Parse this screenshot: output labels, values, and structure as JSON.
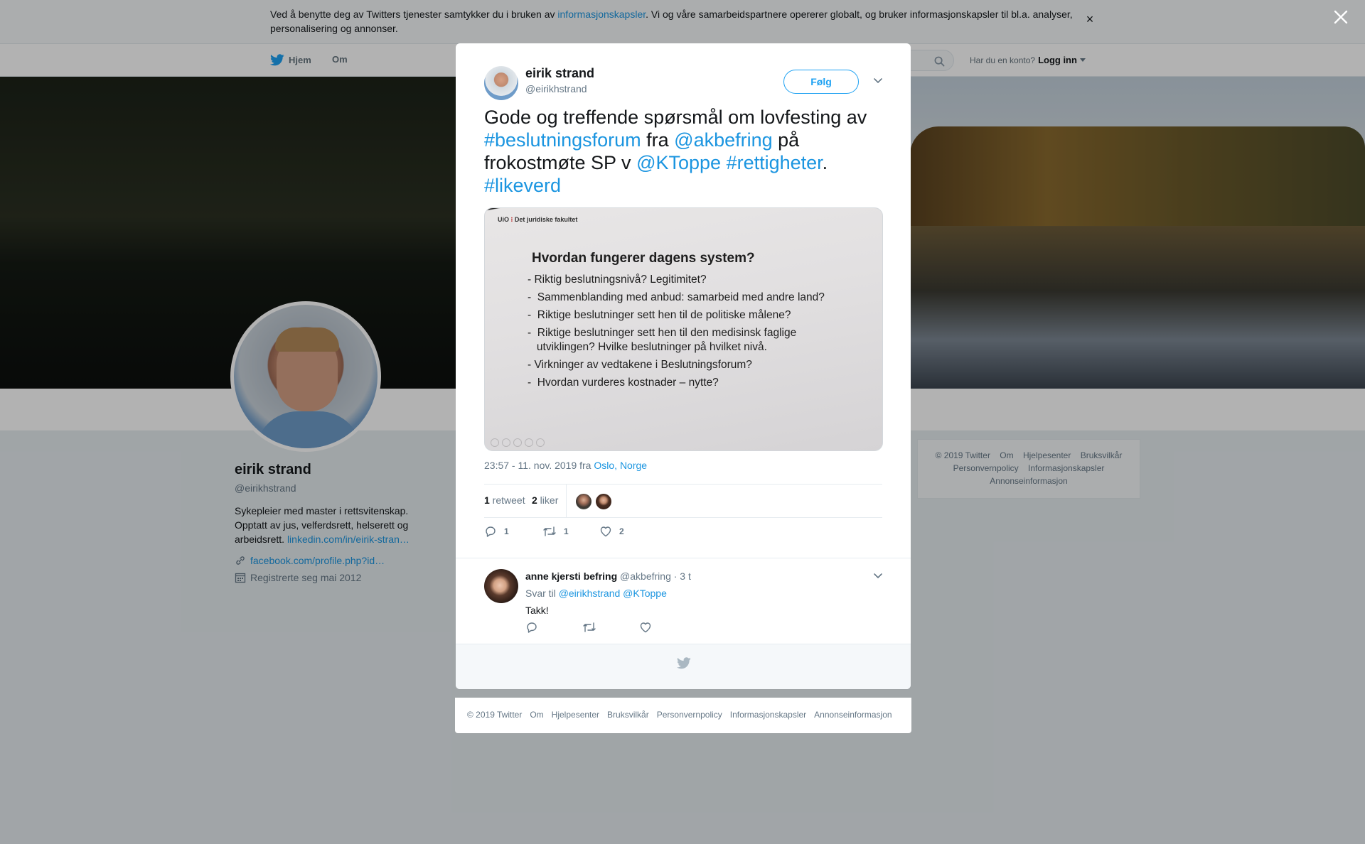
{
  "cookie_banner": {
    "text_before": "Ved å benytte deg av Twitters tjenester samtykker du i bruken av ",
    "link": "informasjonskapsler",
    "text_after": ". Vi og våre samarbeidspartnere opererer globalt, og bruker informasjonskapsler til bl.a. analyser, personalisering og annonser.",
    "close_symbol": "×"
  },
  "nav": {
    "home": "Hjem",
    "about": "Om",
    "account_prompt": "Har du en konto?",
    "login": "Logg inn"
  },
  "profile": {
    "name": "eirik strand",
    "handle": "@eirikhstrand",
    "bio": "Sykepleier med master i rettsvitenskap. Opptatt av jus, velferdsrett, helserett og arbeidsrett. ",
    "bio_link": "linkedin.com/in/eirik-stran…",
    "website": "facebook.com/profile.php?id…",
    "joined": "Registrerte seg mai 2012"
  },
  "side_footer": [
    "© 2019 Twitter",
    "Om",
    "Hjelpesenter",
    "Bruksvilkår",
    "Personvernpolicy",
    "Informasjonskapsler",
    "Annonseinformasjon"
  ],
  "tweet": {
    "author_name": "eirik strand",
    "author_handle": "@eirikhstrand",
    "follow_label": "Følg",
    "text": {
      "t1": "Gode og treffende spørsmål om lovfesting av ",
      "h1": "#beslutningsforum",
      "t2": " fra ",
      "m1": "@akbefring",
      "t3": " på frokostmøte SP v ",
      "m2": "@KToppe",
      "t4": " ",
      "h2": "#rettigheter",
      "t5": ". ",
      "h3": "#likeverd"
    },
    "image": {
      "header_uio": "UiO",
      "header_mark": " ⁝ ",
      "header_faculty": "Det juridiske fakultet",
      "title": "Hvordan fungerer dagens system?",
      "bullets": [
        "- Riktig beslutningsnivå? Legitimitet?",
        "-  Sammenblanding med anbud: samarbeid med andre land?",
        "-  Riktige beslutninger sett hen til de politiske målene?",
        "-  Riktige beslutninger sett hen til den medisinsk faglige",
        "   utviklingen? Hvilke beslutninger på hvilket nivå.",
        "- Virkninger av vedtakene i Beslutningsforum?",
        "-  Hvordan vurderes kostnader – nytte?"
      ]
    },
    "timestamp": "23:57 - 11. nov. 2019 fra ",
    "location": "Oslo, Norge",
    "retweet_count": "1",
    "retweet_label": " retweet",
    "like_count": "2",
    "like_label": " liker",
    "actions": {
      "replies": "1",
      "retweets": "1",
      "likes": "2"
    }
  },
  "reply": {
    "name": "anne kjersti befring",
    "handle": "@akbefring",
    "time": " · 3 t",
    "reply_to_label": "Svar til ",
    "reply_to_1": "@eirikhstrand",
    "reply_to_2": "@KToppe",
    "text": "Takk!"
  },
  "modal_footer": [
    "© 2019 Twitter",
    "Om",
    "Hjelpesenter",
    "Bruksvilkår",
    "Personvernpolicy",
    "Informasjonskapsler",
    "Annonseinformasjon"
  ],
  "colors": {
    "accent": "#1da1f2",
    "link": "#1b95e0",
    "text": "#14171a",
    "muted": "#657786"
  },
  "icons": [
    "twitter-bird-icon",
    "search-icon",
    "close-icon",
    "chevron-down-icon",
    "link-icon",
    "calendar-icon",
    "reply-icon",
    "retweet-icon",
    "heart-icon"
  ]
}
